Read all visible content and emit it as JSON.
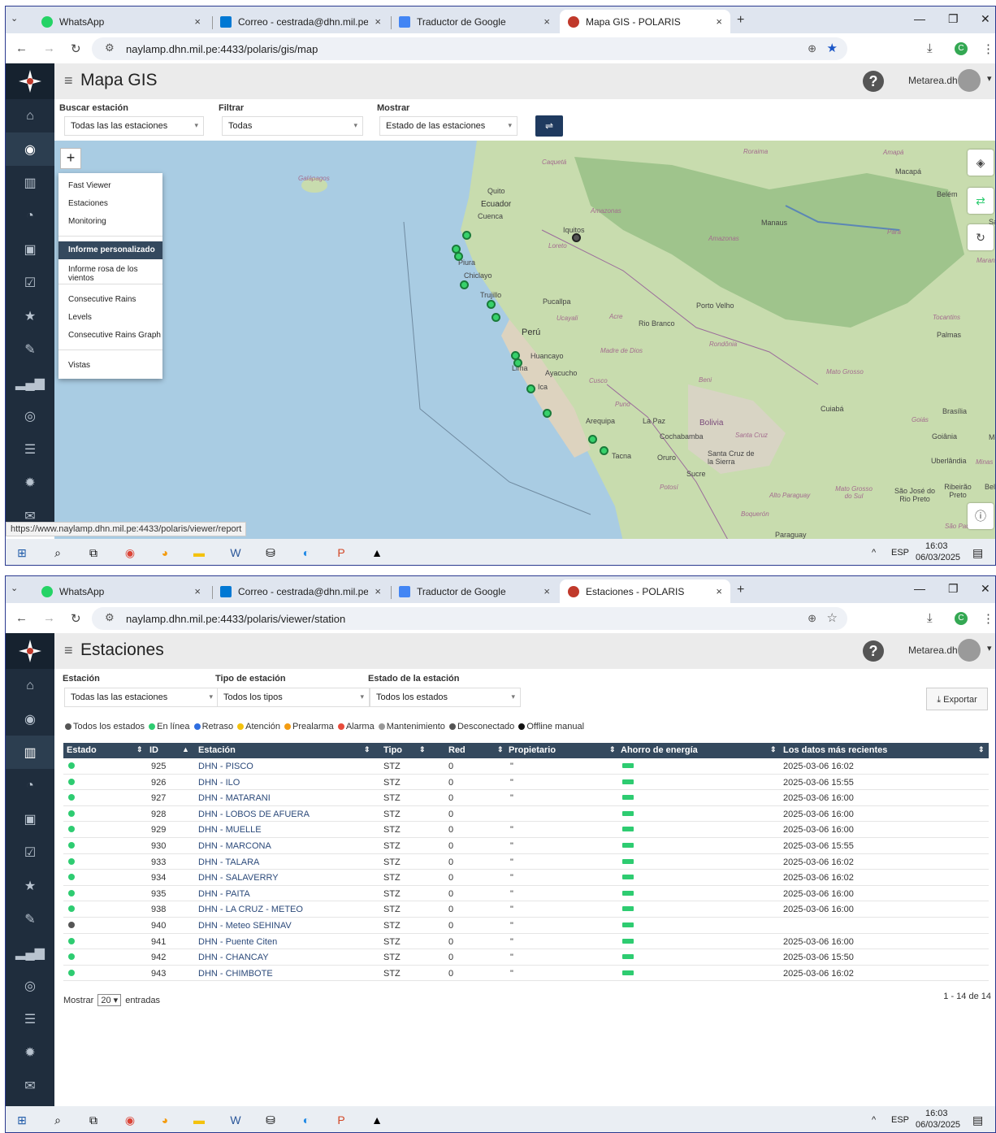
{
  "browser": {
    "tabs_top": [
      {
        "label": "WhatsApp",
        "color": "#25d366"
      },
      {
        "label": "Correo - cestrada@dhn.mil.pe",
        "color": "#0078d4"
      },
      {
        "label": "Traductor de Google",
        "color": "#4285f4"
      },
      {
        "label": "Mapa GIS - POLARIS",
        "color": "#c0392b"
      }
    ],
    "tabs_bottom": [
      {
        "label": "WhatsApp",
        "color": "#25d366"
      },
      {
        "label": "Correo - cestrada@dhn.mil.pe",
        "color": "#0078d4"
      },
      {
        "label": "Traductor de Google",
        "color": "#4285f4"
      },
      {
        "label": "Estaciones - POLARIS",
        "color": "#c0392b"
      }
    ],
    "url_top": "naylamp.dhn.mil.pe:4433/polaris/gis/map",
    "url_bottom": "naylamp.dhn.mil.pe:4433/polaris/viewer/station",
    "avatar_letter": "C"
  },
  "app": {
    "user": "Metarea.dhn",
    "help": "?"
  },
  "map_page": {
    "title": "Mapa GIS",
    "filters": [
      {
        "label": "Buscar estación",
        "value": "Todas las las estaciones"
      },
      {
        "label": "Filtrar",
        "value": "Todas"
      },
      {
        "label": "Mostrar",
        "value": "Estado de las estaciones"
      }
    ],
    "zoom": "+",
    "menu": {
      "items": [
        "Fast Viewer",
        "Estaciones",
        "Monitoring",
        "Informe personalizado",
        "Informe rosa de los vientos",
        "Consecutive Rains",
        "Levels",
        "Consecutive Rains Graph",
        "Vistas"
      ],
      "highlighted": "Informe personalizado"
    },
    "status_url": "https://www.naylamp.dhn.mil.pe:4433/polaris/viewer/report",
    "map_labels": [
      "Galápagos",
      "Quito",
      "Ecuador",
      "Cuenca",
      "Iquitos",
      "Loreto",
      "Amazonas",
      "Piura",
      "Chiclayo",
      "Trujillo",
      "Pucallpa",
      "Ucayali",
      "Perú",
      "Huancayo",
      "Lima",
      "Ayacucho",
      "Ica",
      "Cusco",
      "Madre de Dios",
      "Acre",
      "Rio Branco",
      "Porto Velho",
      "Rondônia",
      "Manaus",
      "Amazonas",
      "Roraima",
      "Amapá",
      "Macapá",
      "Belém",
      "Pará",
      "Puno",
      "Arequipa",
      "La Paz",
      "Bolivia",
      "Cochabamba",
      "Santa Cruz",
      "Oruro",
      "Santa Cruz de la Sierra",
      "Sucre",
      "Tacna",
      "Potosí",
      "Beni",
      "Mato Grosso",
      "Cuiabá",
      "Goiás",
      "Goiânia",
      "Brasília",
      "Tocantins",
      "Palmas",
      "Uberlândia",
      "Minas Ge",
      "Ribeirão Preto",
      "São José do Rio Preto",
      "Mato Grosso do Sul",
      "Alto Paraguay",
      "Boquerón",
      "Paraguay",
      "São Paulo",
      "Caquetá",
      "Maranh",
      "Bel",
      "Mo",
      "Sa"
    ]
  },
  "stations_page": {
    "title": "Estaciones",
    "filters": [
      {
        "label": "Estación",
        "value": "Todas las las estaciones"
      },
      {
        "label": "Tipo de estación",
        "value": "Todos los tipos"
      },
      {
        "label": "Estado de la estación",
        "value": "Todos los estados"
      }
    ],
    "export": "Exportar",
    "legend": [
      {
        "label": "Todos los estados",
        "color": "#555555"
      },
      {
        "label": "En línea",
        "color": "#2ecc71"
      },
      {
        "label": "Retraso",
        "color": "#2f6ee0"
      },
      {
        "label": "Atención",
        "color": "#f4c20d"
      },
      {
        "label": "Prealarma",
        "color": "#f39c12"
      },
      {
        "label": "Alarma",
        "color": "#e74c3c"
      },
      {
        "label": "Mantenimiento",
        "color": "#999999"
      },
      {
        "label": "Desconectado",
        "color": "#555555"
      },
      {
        "label": "Offline manual",
        "color": "#111111"
      }
    ],
    "columns": [
      "Estado",
      "ID",
      "Estación",
      "Tipo",
      "Red",
      "Propietario",
      "Ahorro de energía",
      "Los datos más recientes"
    ],
    "rows": [
      {
        "status": "#2ecc71",
        "id": "925",
        "name": "DHN - PISCO",
        "type": "STZ",
        "red": "0",
        "owner": "\"",
        "last": "2025-03-06 16:02"
      },
      {
        "status": "#2ecc71",
        "id": "926",
        "name": "DHN - ILO",
        "type": "STZ",
        "red": "0",
        "owner": "\"",
        "last": "2025-03-06 15:55"
      },
      {
        "status": "#2ecc71",
        "id": "927",
        "name": "DHN - MATARANI",
        "type": "STZ",
        "red": "0",
        "owner": "\"",
        "last": "2025-03-06 16:00"
      },
      {
        "status": "#2ecc71",
        "id": "928",
        "name": "DHN - LOBOS DE AFUERA",
        "type": "STZ",
        "red": "0",
        "owner": "",
        "last": "2025-03-06 16:00"
      },
      {
        "status": "#2ecc71",
        "id": "929",
        "name": "DHN - MUELLE",
        "type": "STZ",
        "red": "0",
        "owner": "\"",
        "last": "2025-03-06 16:00"
      },
      {
        "status": "#2ecc71",
        "id": "930",
        "name": "DHN - MARCONA",
        "type": "STZ",
        "red": "0",
        "owner": "\"",
        "last": "2025-03-06 15:55"
      },
      {
        "status": "#2ecc71",
        "id": "933",
        "name": "DHN - TALARA",
        "type": "STZ",
        "red": "0",
        "owner": "\"",
        "last": "2025-03-06 16:02"
      },
      {
        "status": "#2ecc71",
        "id": "934",
        "name": "DHN - SALAVERRY",
        "type": "STZ",
        "red": "0",
        "owner": "\"",
        "last": "2025-03-06 16:02"
      },
      {
        "status": "#2ecc71",
        "id": "935",
        "name": "DHN - PAITA",
        "type": "STZ",
        "red": "0",
        "owner": "\"",
        "last": "2025-03-06 16:00"
      },
      {
        "status": "#2ecc71",
        "id": "938",
        "name": "DHN - LA CRUZ - METEO",
        "type": "STZ",
        "red": "0",
        "owner": "\"",
        "last": "2025-03-06 16:00"
      },
      {
        "status": "#555555",
        "id": "940",
        "name": "DHN - Meteo SEHINAV",
        "type": "STZ",
        "red": "0",
        "owner": "\"",
        "last": ""
      },
      {
        "status": "#2ecc71",
        "id": "941",
        "name": "DHN - Puente Citen",
        "type": "STZ",
        "red": "0",
        "owner": "\"",
        "last": "2025-03-06 16:00"
      },
      {
        "status": "#2ecc71",
        "id": "942",
        "name": "DHN - CHANCAY",
        "type": "STZ",
        "red": "0",
        "owner": "\"",
        "last": "2025-03-06 15:50"
      },
      {
        "status": "#2ecc71",
        "id": "943",
        "name": "DHN - CHIMBOTE",
        "type": "STZ",
        "red": "0",
        "owner": "\"",
        "last": "2025-03-06 16:02"
      }
    ],
    "show_label": "Mostrar",
    "show_value": "20",
    "entries_label": "entradas",
    "pagination": "1 - 14 de 14"
  },
  "taskbar": {
    "lang": "ESP",
    "time": "16:03",
    "date": "06/03/2025"
  }
}
